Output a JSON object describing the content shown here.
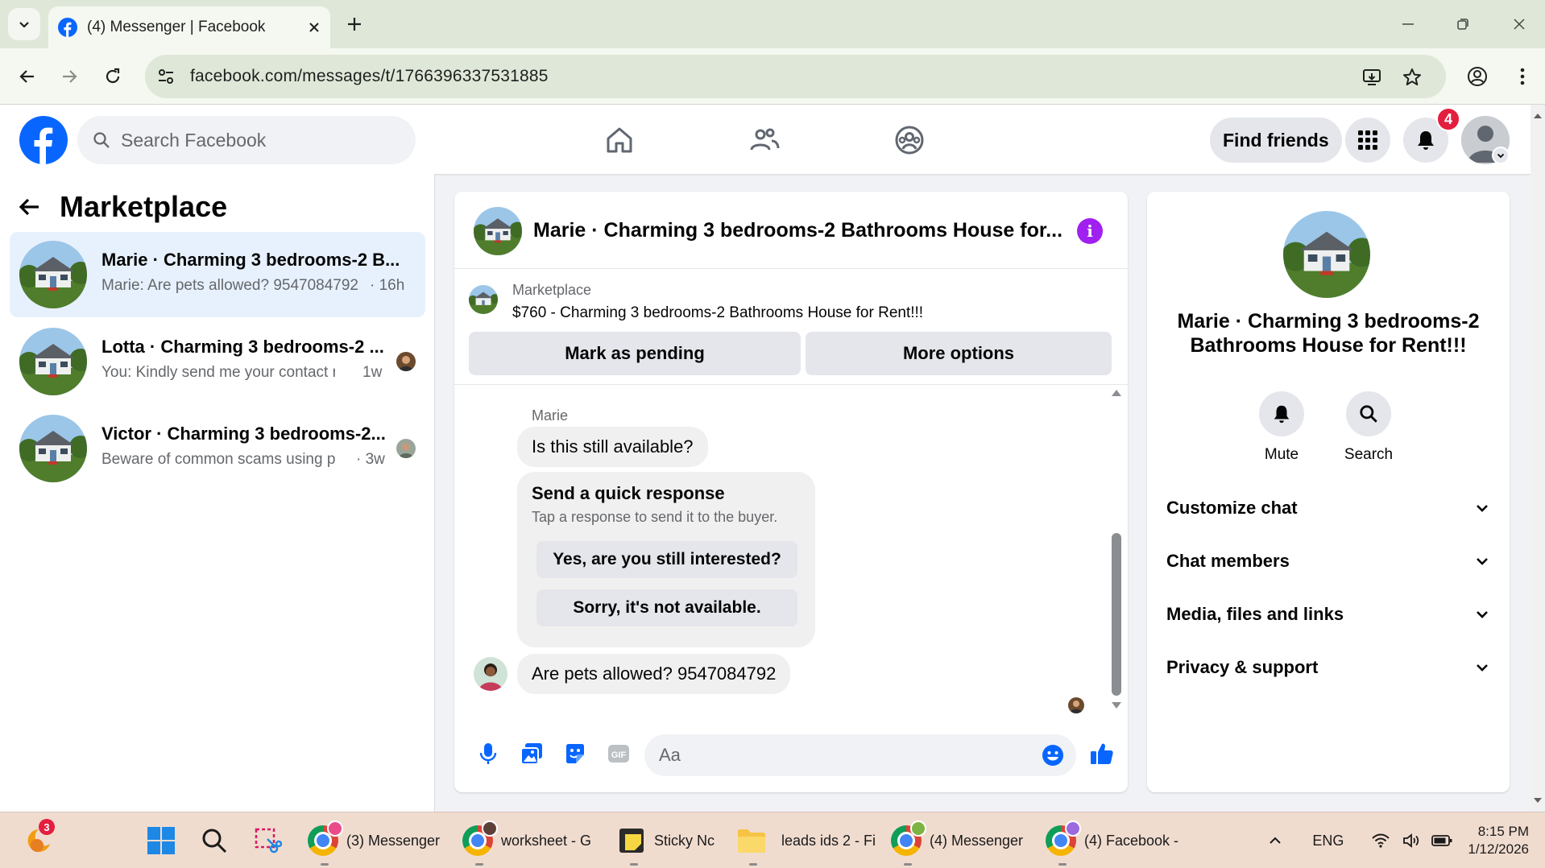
{
  "browser": {
    "tab_title": "(4) Messenger | Facebook",
    "url": "facebook.com/messages/t/1766396337531885"
  },
  "header": {
    "search_placeholder": "Search Facebook",
    "find_friends_label": "Find friends",
    "notifications_count": "4"
  },
  "sidebar": {
    "title": "Marketplace",
    "conversations": [
      {
        "title": "Marie · Charming 3 bedrooms-2 B...",
        "snippet": "Marie: Are pets allowed? 9547084792",
        "time": "· 16h",
        "active": true
      },
      {
        "title": "Lotta · Charming 3 bedrooms-2 ...",
        "snippet": "You: Kindly send me your contact n...",
        "time": "1w",
        "active": false
      },
      {
        "title": "Victor · Charming 3 bedrooms-2...",
        "snippet": "Beware of common scams using p...",
        "time": "· 3w",
        "active": false
      }
    ]
  },
  "chat": {
    "title": "Marie · Charming 3 bedrooms-2 Bathrooms House for...",
    "listing_label": "Marketplace",
    "listing_title": "$760 - Charming 3 bedrooms-2 Bathrooms House for Rent!!!",
    "mark_pending_label": "Mark as pending",
    "more_options_label": "More options",
    "sender_name": "Marie",
    "message_1": "Is this still available?",
    "quick_response_title": "Send a quick response",
    "quick_response_subtitle": "Tap a response to send it to the buyer.",
    "quick_reply_1": "Yes, are you still interested?",
    "quick_reply_2": "Sorry, it's not available.",
    "message_2": "Are pets allowed? 9547084792",
    "composer_placeholder": "Aa"
  },
  "info_panel": {
    "title": "Marie · Charming 3 bedrooms-2 Bathrooms House for Rent!!!",
    "mute_label": "Mute",
    "search_label": "Search",
    "sections": [
      "Customize chat",
      "Chat members",
      "Media, files and links",
      "Privacy & support"
    ]
  },
  "taskbar": {
    "weather_badge": "3",
    "apps": [
      {
        "label": "(3) Messenger"
      },
      {
        "label": "worksheet - G"
      },
      {
        "label": "Sticky Nc"
      },
      {
        "label": "leads ids 2 - Fi"
      },
      {
        "label": "(4) Messenger"
      },
      {
        "label": "(4) Facebook -"
      }
    ],
    "language": "ENG",
    "time": "8:15 PM",
    "date": "1/12/2026"
  },
  "colors": {
    "facebook_blue": "#0866ff",
    "active_conversation": "#e7f1fe",
    "info_purple": "#a020f0",
    "badge_red": "#e41e3f"
  }
}
